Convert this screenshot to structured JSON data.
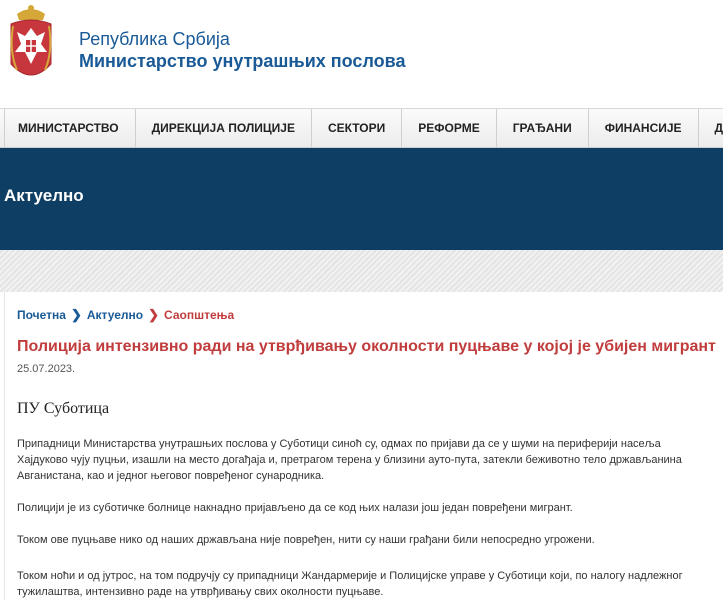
{
  "header": {
    "republic": "Република Србија",
    "ministry": "Министарство унутрашњих послова",
    "coat_colors": {
      "shield": "#c7363d",
      "eagle": "#ffffff",
      "crown": "#d4a738"
    }
  },
  "nav": {
    "items": [
      {
        "label": "МИНИСТАРСТВО"
      },
      {
        "label": "ДИРЕКЦИЈА ПОЛИЦИЈЕ"
      },
      {
        "label": "СЕКТОРИ"
      },
      {
        "label": "РЕФОРМЕ"
      },
      {
        "label": "ГРАЂАНИ"
      },
      {
        "label": "ФИНАНСИЈЕ"
      },
      {
        "label": "ДОКУМЕНТ"
      }
    ]
  },
  "banner": {
    "title": "Актуелно",
    "color": "#0e3e63"
  },
  "breadcrumb": {
    "home": "Почетна",
    "section": "Актуелно",
    "current": "Саопштења",
    "separator_icon": "chevron-right-icon"
  },
  "article": {
    "title": "Полиција интензивно ради на утврђивању околности пуцњаве у којој је убијен мигрант",
    "date": "25.07.2023.",
    "unit": "ПУ Суботица",
    "paragraphs": [
      "Припадници Министарства унутрашњих послова у Суботици синоћ су, одмах по пријави да се у шуми на периферији насеља Хајдуково чују пуцњи, изашли на место догађаја и, претрагом терена у близини ауто-пута, затекли беживотно тело држављанина Авганистана, као и једног његовог повређеног сународника.",
      "Полицији је из суботичке болнице накнадно пријављено да се код њих налази још један повређени мигрант.",
      "Током ове пуцњаве нико од наших држављана није повређен, нити су наши грађани били непосредно угрожени.",
      "Током ноћи и од јутрос, на том подручју су припадници Жандармерије и Полицијске управе у Суботици који, по налогу надлежног тужилаштва, интензивно раде на утврђивању свих околности пуцњаве."
    ]
  }
}
